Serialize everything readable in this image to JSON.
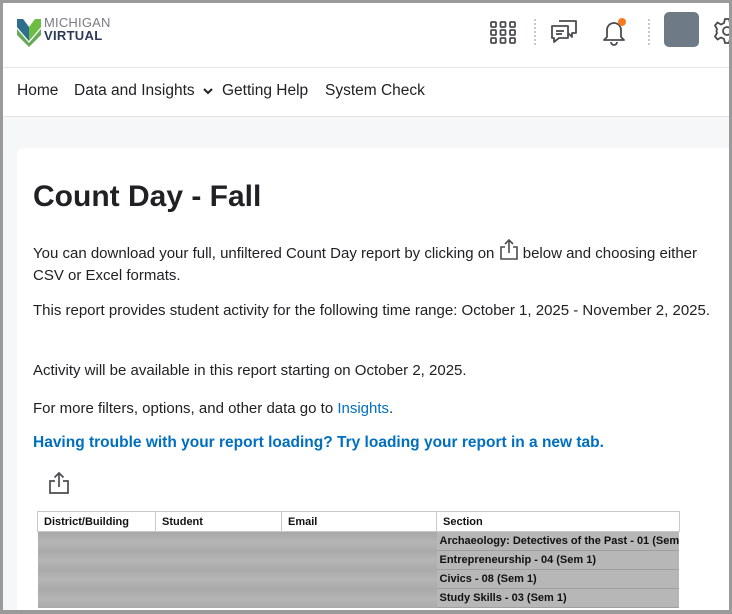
{
  "header": {
    "logo_line1": "MICHIGAN",
    "logo_line2": "VIRTUAL",
    "icons": [
      "apps-grid-icon",
      "chat-icon",
      "bell-icon",
      "avatar",
      "gear-icon"
    ],
    "notification_dot_color": "#f47b20"
  },
  "nav": {
    "items": [
      "Home",
      "Data and Insights",
      "Getting Help",
      "System Check"
    ],
    "dropdown_item_index": 1
  },
  "content": {
    "title": "Count Day - Fall",
    "p1_before": "You can download your full, unfiltered Count Day report by clicking on",
    "p1_after": "below and choosing either CSV or Excel formats.",
    "p2": "This report provides student activity for the following time range:  October 1, 2025 - November 2, 2025.",
    "p3": "Activity will be available in this report starting on October 2, 2025.",
    "p4_before": "For more filters, options, and other data go to",
    "p4_link": "Insights",
    "p4_after": ".",
    "trouble_link": "Having trouble with your report loading? Try loading your report in a new tab.",
    "link_color": "#006fbf"
  },
  "table": {
    "columns": [
      "District/Building",
      "Student",
      "Email",
      "Section"
    ],
    "sections": [
      "Archaeology: Detectives of the Past - 01 (Sem",
      "Entrepreneurship - 04 (Sem 1)",
      "Civics - 08 (Sem 1)",
      "Study Skills - 03 (Sem 1)"
    ]
  }
}
